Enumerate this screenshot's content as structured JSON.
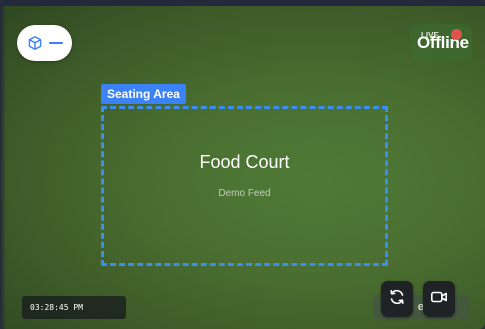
{
  "zone_pill": {
    "icon": "cube-icon",
    "accent": "#3b82f6"
  },
  "status": {
    "offline_text": "Offline",
    "live_text": "LIVE",
    "rec_color": "#e0524a"
  },
  "zone": {
    "label": "Seating Area",
    "color": "#3b82f6"
  },
  "feed": {
    "title": "Food Court",
    "subtitle": "Demo Feed"
  },
  "overlay": {
    "timestamp": "03:28:45 PM"
  },
  "controls": {
    "hidden_button_label": "e",
    "refresh_icon": "refresh-icon",
    "camera_icon": "video-camera-icon"
  }
}
